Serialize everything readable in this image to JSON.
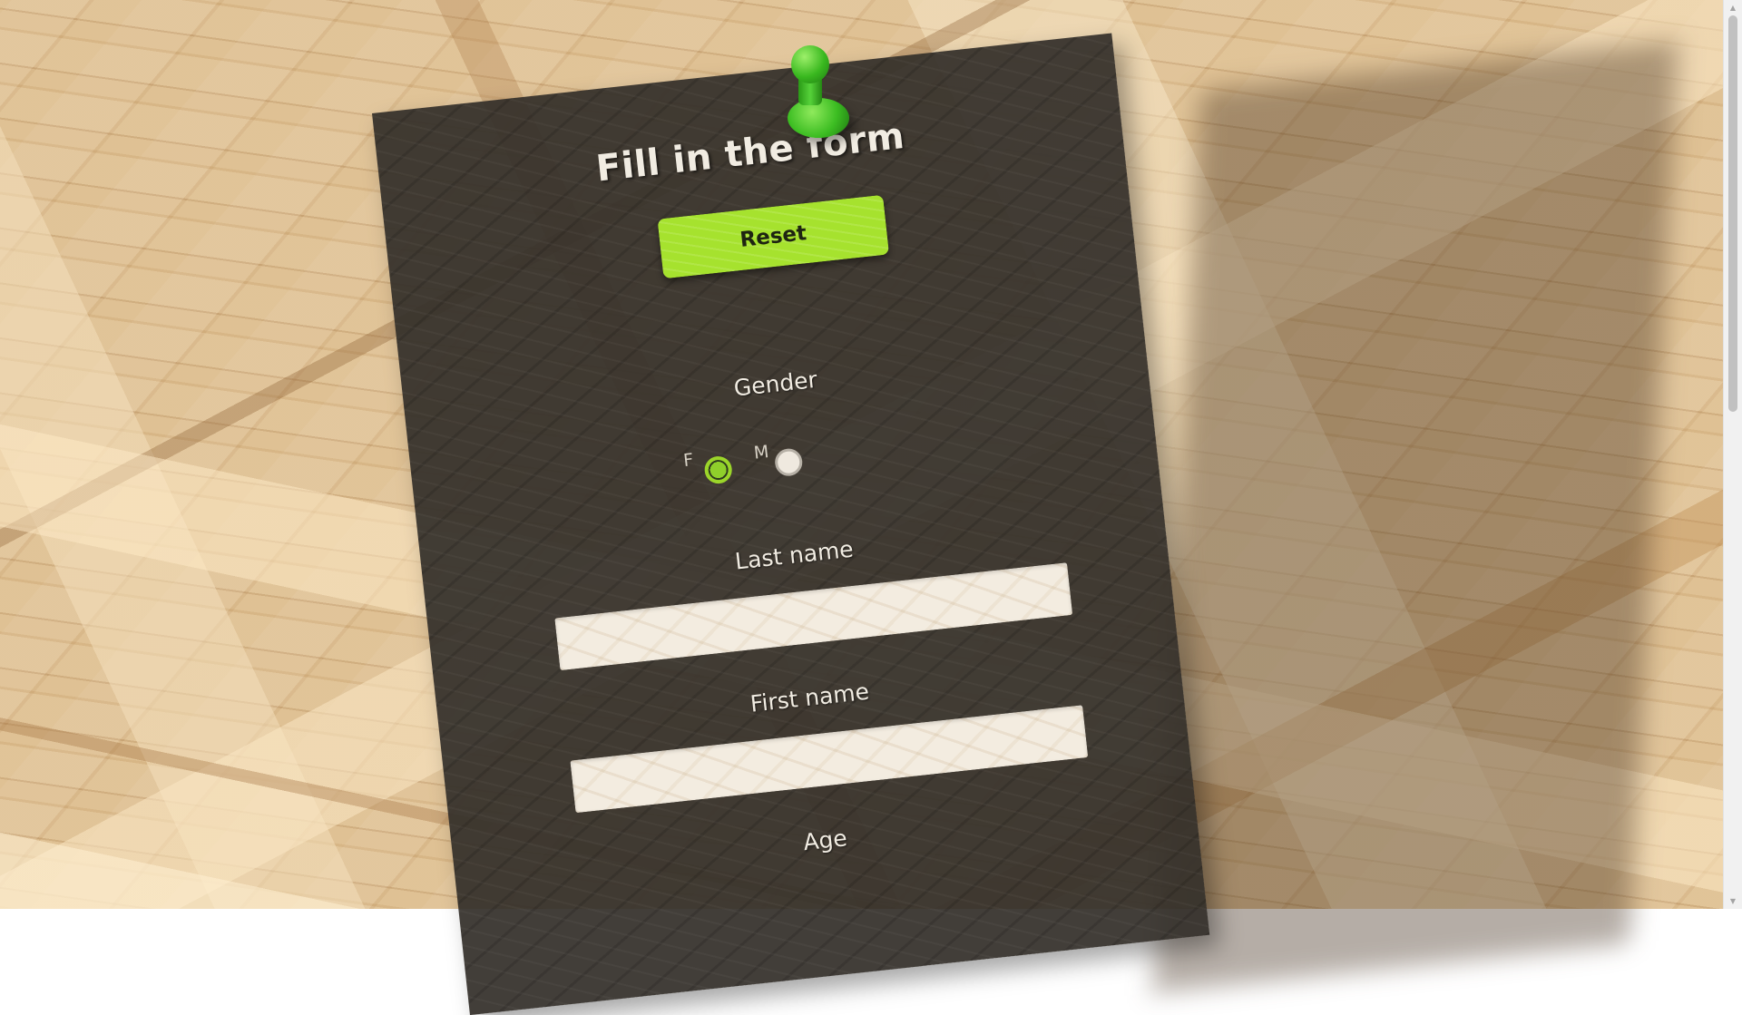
{
  "form": {
    "title": "Fill in the form",
    "reset_label": "Reset",
    "gender_label": "Gender",
    "gender_options": [
      {
        "letter": "F",
        "checked": true
      },
      {
        "letter": "M",
        "checked": false
      }
    ],
    "last_name_label": "Last name",
    "last_name_value": "",
    "first_name_label": "First name",
    "first_name_value": "",
    "age_label": "Age"
  },
  "colors": {
    "accent_green": "#a6e22e",
    "paper": "#342f2a",
    "pin_green": "#39b81f"
  },
  "icons": {
    "pin": "pushpin-icon"
  }
}
